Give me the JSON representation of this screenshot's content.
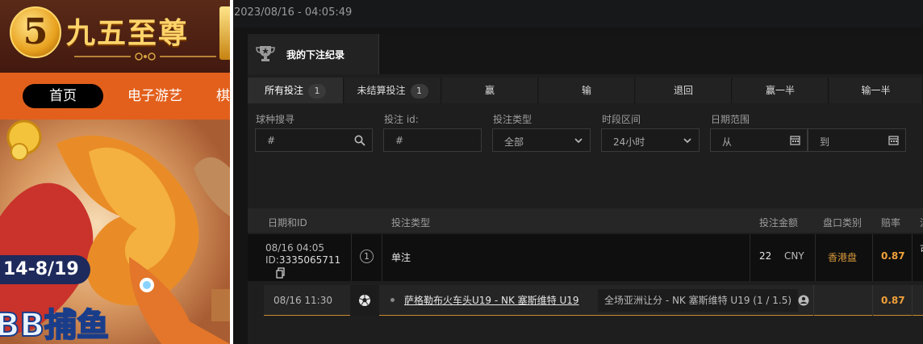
{
  "site": {
    "logo_mark": "5",
    "logo_text": "九五至尊",
    "nav": [
      "首页",
      "电子游艺",
      "棋"
    ],
    "promo_date": "14-8/19",
    "promo_title": "BB捕鱼"
  },
  "app": {
    "timestamp": "2023/08/16 - 04:05:49",
    "header_title": "我的下注纪录",
    "tabs": [
      {
        "label": "所有投注",
        "count": "1"
      },
      {
        "label": "未结算投注",
        "count": "1"
      },
      {
        "label": "赢"
      },
      {
        "label": "输"
      },
      {
        "label": "退回"
      },
      {
        "label": "赢一半"
      },
      {
        "label": "输一半"
      }
    ],
    "filters": {
      "sport_search": {
        "label": "球种搜寻",
        "value": "#"
      },
      "bet_id": {
        "label": "投注 id:",
        "value": "#"
      },
      "bet_type": {
        "label": "投注类型",
        "value": "全部"
      },
      "time_range": {
        "label": "时段区间",
        "value": "24小时"
      },
      "date_range": {
        "label": "日期范围",
        "from": "从",
        "to": "到"
      }
    },
    "table": {
      "headers": [
        "日期和ID",
        "投注类型",
        "投注金额",
        "盘口类别",
        "赔率",
        "流"
      ],
      "row": {
        "date": "08/16 04:05",
        "id_label": "ID:",
        "id": "3335065711",
        "count": "1",
        "bet_type": "单注",
        "amount": "22",
        "currency": "CNY",
        "odds_type": "香港盘",
        "odds": "0.87",
        "extra": "可"
      },
      "detail": {
        "time": "08/16 11:30",
        "match": "萨格勒布火车头U19 - NK 塞斯维特 U19",
        "market": "全场亚洲让分 - NK 塞斯维特 U19 (1 / 1.5)",
        "odds": "0.87"
      }
    },
    "colors": {
      "accent": "#f0a13a",
      "brand_orange": "#e2601c"
    }
  }
}
